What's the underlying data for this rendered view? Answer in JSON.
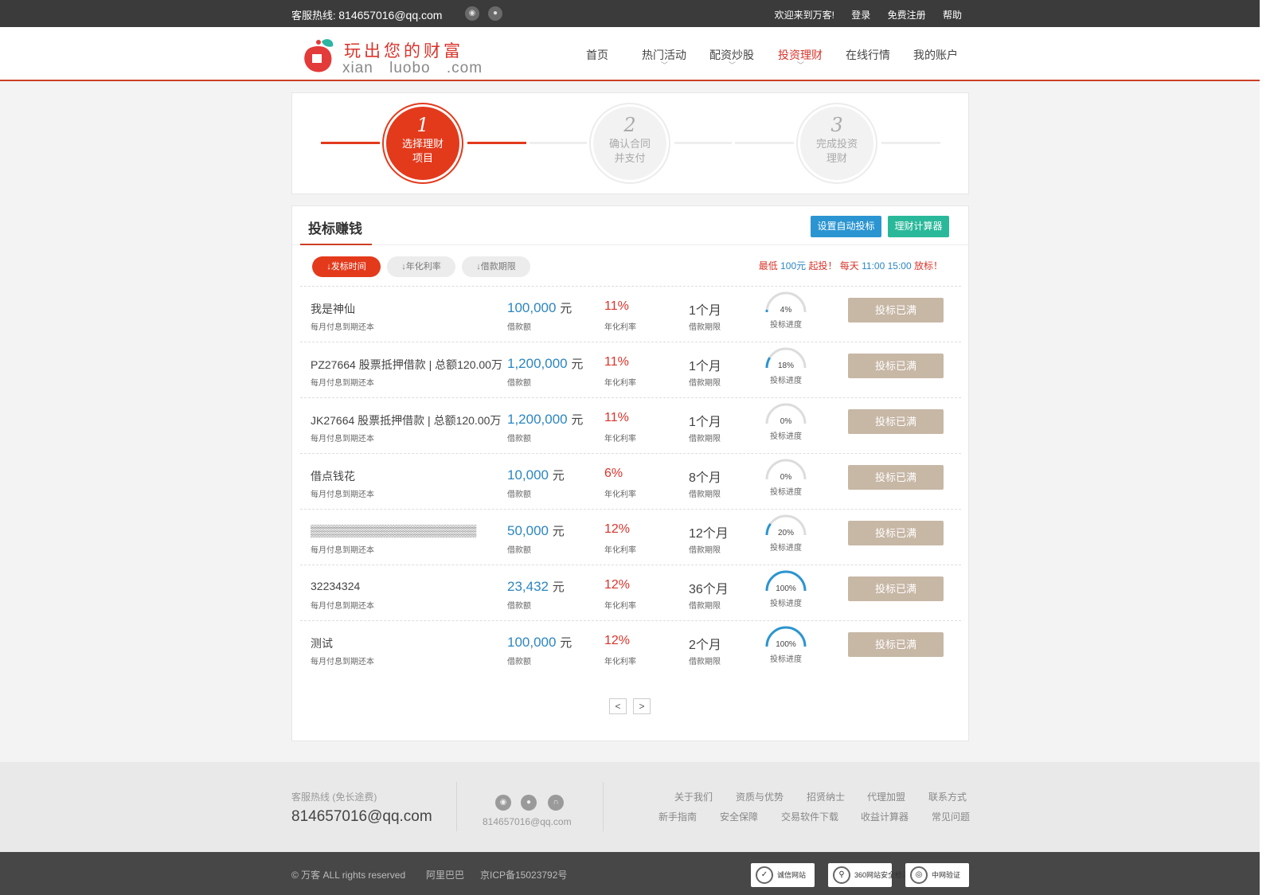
{
  "topbar": {
    "hotline_label": "客服热线:",
    "hotline_value": "814657016@qq.com",
    "welcome": "欢迎来到万客!",
    "login": "登录",
    "register": "免费注册",
    "help": "帮助"
  },
  "logo": {
    "slogan": "玩出您的财富",
    "domain": "xian luobo .com"
  },
  "nav": [
    "首页",
    "热门活动",
    "配资炒股",
    "投资理财",
    "在线行情",
    "我的账户"
  ],
  "steps": [
    {
      "num": "1",
      "label": "选择理财项目"
    },
    {
      "num": "2",
      "label": "确认合同并支付"
    },
    {
      "num": "3",
      "label": "完成投资理财"
    }
  ],
  "panel": {
    "title": "投标赚钱",
    "auto_bid_button": "设置自动投标",
    "calculator_button": "理财计算器",
    "sort_buttons": [
      "↓发标时间",
      "↓年化利率",
      "↓借款期限"
    ],
    "notice": {
      "p1": "最低 ",
      "amount": "100元",
      "p2": " 起投！ 每天 ",
      "times": "11:00 15:00",
      "p3": " 放标！"
    },
    "labels": {
      "repay": "每月付息到期还本",
      "amount": "借款额",
      "rate": "年化利率",
      "term": "借款期限",
      "progress": "投标进度",
      "status": "投标已满"
    },
    "rows": [
      {
        "name": "我是神仙",
        "amount": "100,000",
        "unit": "元",
        "rate": "11%",
        "term": "1个月",
        "progress": 4
      },
      {
        "name": "PZ27664 股票抵押借款 | 总额120.00万",
        "amount": "1,200,000",
        "unit": "元",
        "rate": "11%",
        "term": "1个月",
        "progress": 18
      },
      {
        "name": "JK27664 股票抵押借款 | 总额120.00万",
        "amount": "1,200,000",
        "unit": "元",
        "rate": "11%",
        "term": "1个月",
        "progress": 0
      },
      {
        "name": "借点钱花",
        "amount": "10,000",
        "unit": "元",
        "rate": "6%",
        "term": "8个月",
        "progress": 0
      },
      {
        "name": "▒▒▒▒▒▒▒▒▒▒▒▒▒▒▒▒▒▒▒▒▒",
        "amount": "50,000",
        "unit": "元",
        "rate": "12%",
        "term": "12个月",
        "progress": 20
      },
      {
        "name": "32234324",
        "amount": "23,432",
        "unit": "元",
        "rate": "12%",
        "term": "36个月",
        "progress": 100
      },
      {
        "name": "测试",
        "amount": "100,000",
        "unit": "元",
        "rate": "12%",
        "term": "2个月",
        "progress": 100
      }
    ],
    "pager": {
      "prev": "<",
      "next": ">"
    }
  },
  "footer": {
    "hotline_label": "客服热线 (免长途费)",
    "hotline_value": "814657016@qq.com",
    "social_mail": "814657016@qq.com",
    "links_row1": [
      "关于我们",
      "资质与优势",
      "招贤纳士",
      "代理加盟",
      "联系方式"
    ],
    "links_row2": [
      "新手指南",
      "安全保障",
      "交易软件下载",
      "收益计算器",
      "常见问题"
    ],
    "copyright": "© 万客 ALL rights reserved",
    "partner": "阿里巴巴",
    "icp": "京ICP备15023792号",
    "badges": [
      "诚信网站",
      "360网站安全检测",
      "中网验证"
    ]
  },
  "colors": {
    "accent": "#e33a1c",
    "link": "#2b86c2",
    "button_full": "#c7b7a5",
    "auto_bid": "#2b95d1",
    "calculator": "#2ab89a"
  }
}
